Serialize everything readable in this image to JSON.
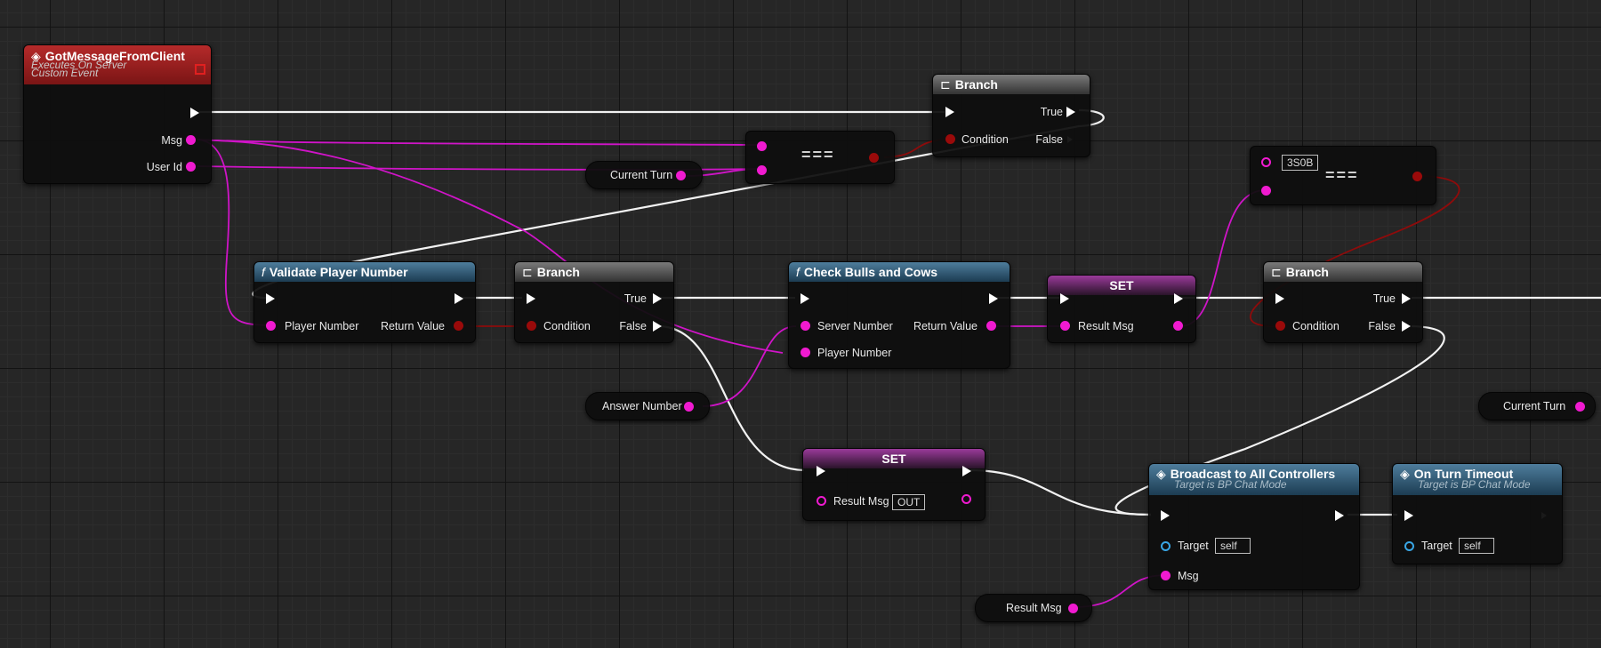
{
  "event_node": {
    "title": "GotMessageFromClient",
    "subtitle_1": "Executes On Server",
    "subtitle_2": "Custom Event",
    "pins": [
      "Msg",
      "User Id"
    ]
  },
  "branch_top": {
    "title": "Branch",
    "true_label": "True",
    "false_label": "False",
    "condition_label": "Condition"
  },
  "equal_top": {
    "symbol": "==="
  },
  "current_turn_1": {
    "label": "Current Turn"
  },
  "validate": {
    "title": "Validate Player Number",
    "in_label": "Player Number",
    "out_label": "Return Value"
  },
  "branch_mid": {
    "title": "Branch",
    "true_label": "True",
    "false_label": "False",
    "condition_label": "Condition"
  },
  "check": {
    "title": "Check Bulls and Cows",
    "in1": "Server Number",
    "in2": "Player Number",
    "out_label": "Return Value"
  },
  "set_1": {
    "title": "SET",
    "pin_label": "Result Msg"
  },
  "equal_right": {
    "literal": "3S0B",
    "symbol": "==="
  },
  "branch_right": {
    "title": "Branch",
    "true_label": "True",
    "false_label": "False",
    "condition_label": "Condition"
  },
  "answer_number": {
    "label": "Answer Number"
  },
  "current_turn_2": {
    "label": "Current Turn"
  },
  "set_2": {
    "title": "SET",
    "pin_label": "Result Msg",
    "literal": "OUT"
  },
  "broadcast": {
    "title": "Broadcast to All Controllers",
    "subtitle": "Target is BP Chat Mode",
    "target_label": "Target",
    "target_value": "self",
    "msg_label": "Msg"
  },
  "turn_timeout": {
    "title": "On Turn Timeout",
    "subtitle": "Target is BP Chat Mode",
    "target_label": "Target",
    "target_value": "self"
  },
  "result_msg_var": {
    "label": "Result Msg"
  },
  "colors": {
    "string_pin": "#f01ad0",
    "bool_pin": "#9a0a0a",
    "object_pin": "#39a6e5",
    "exec": "#ffffff"
  }
}
